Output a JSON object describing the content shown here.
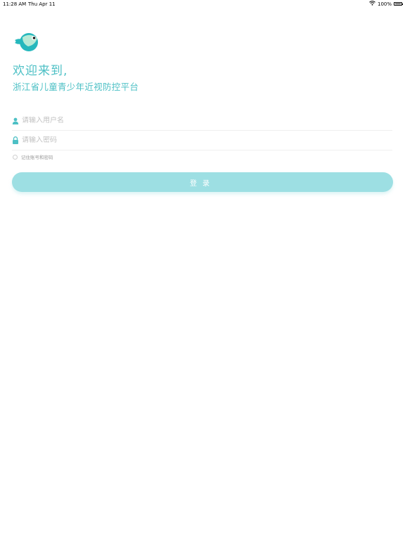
{
  "status_bar": {
    "time": "11:28 AM",
    "date": "Thu Apr 11",
    "battery": "100%",
    "battery_level": 1.0
  },
  "header": {
    "welcome": "欢迎来到,",
    "platform_name": "浙江省儿童青少年近视防控平台"
  },
  "form": {
    "username_placeholder": "请输入用户名",
    "password_placeholder": "请输入密码",
    "username_value": "",
    "password_value": "",
    "remember_label": "记住账号和密码",
    "remember_checked": false,
    "login_label": "登录"
  },
  "colors": {
    "brand": "#4dc0c5",
    "button": "#9ddfe3",
    "logo_dark": "#26b8bd",
    "logo_light": "#b8ead6"
  },
  "icons": {
    "logo": "fish-logo-icon",
    "username": "user-icon",
    "password": "lock-icon",
    "wifi": "wifi-icon",
    "battery": "battery-icon"
  }
}
